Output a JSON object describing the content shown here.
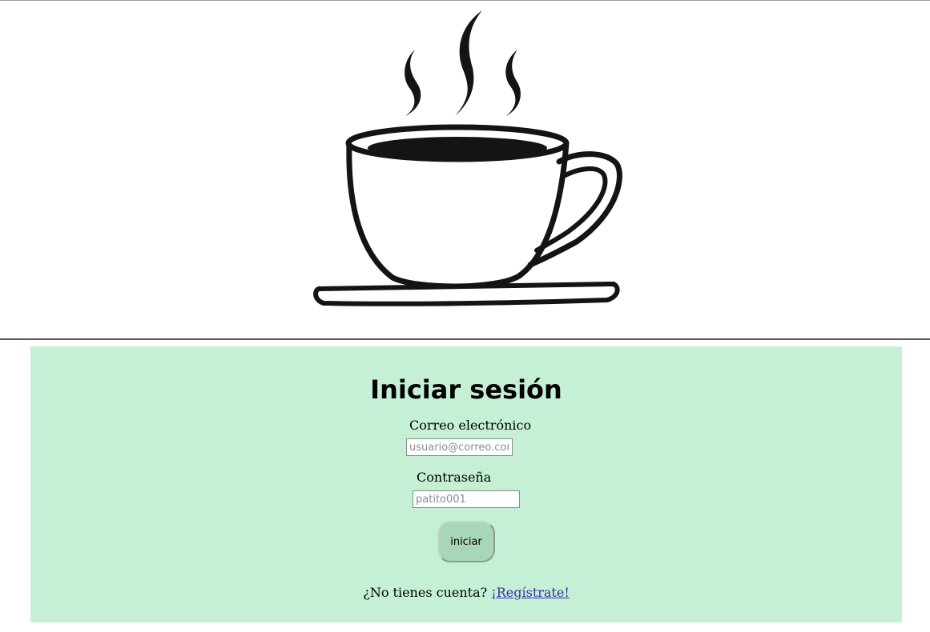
{
  "header": {
    "logo_icon": "coffee-cup-icon"
  },
  "login": {
    "title": "Iniciar sesión",
    "email_label": "Correo electrónico",
    "email_placeholder": "usuario@correo.com",
    "email_value": "",
    "password_label": "Contraseña",
    "password_placeholder": "patito001",
    "password_value": "",
    "submit_label": "iniciar",
    "no_account_text": "¿No tienes cuenta? ",
    "register_link": "¡Regístrate!"
  },
  "colors": {
    "panel_background": "#c5f0d5",
    "button_background": "#a8d6b8",
    "link": "#3a2ea8"
  }
}
